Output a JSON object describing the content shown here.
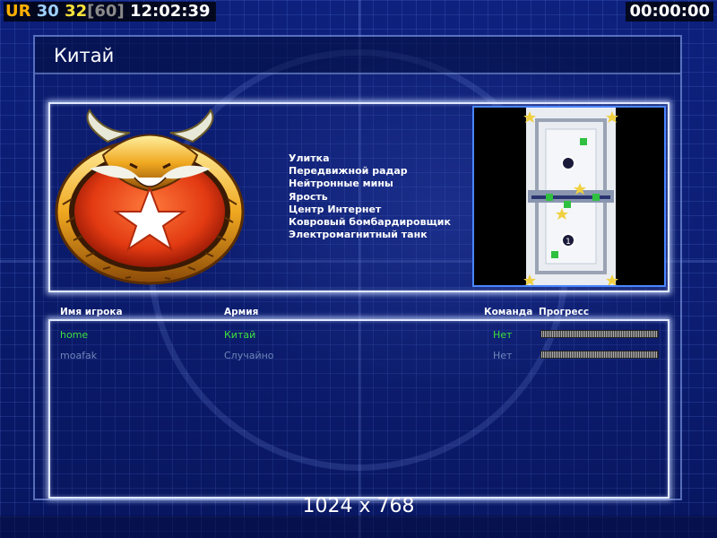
{
  "hud": {
    "tag": "UR",
    "ping": "30",
    "fps": "32",
    "fps_limit": "[60]",
    "clock": "12:02:39",
    "game_timer": "00:00:00"
  },
  "faction": {
    "title": "Китай",
    "emblem_icon": "china-dragon-emblem-icon",
    "units": [
      "Улитка",
      "Передвижной радар",
      "Нейтронные мины",
      "Ярость",
      "Центр Интернет",
      "Ковровый бомбардировщик",
      "Электромагнитный танк"
    ]
  },
  "map_preview": {
    "icon": "minimap-preview",
    "start_positions": [
      "1"
    ]
  },
  "players_table": {
    "headers": {
      "name": "Имя игрока",
      "army": "Армия",
      "team": "Команда",
      "progress": "Прогресс"
    },
    "rows": [
      {
        "name": "home",
        "army": "Китай",
        "team": "Нет",
        "progress": 1.0,
        "color": "#3fe03f"
      },
      {
        "name": "moafak",
        "army": "Случайно",
        "team": "Нет",
        "progress": 1.0,
        "color": "#6f86b8"
      }
    ]
  },
  "footer": {
    "resolution": "1024 x 768"
  },
  "colors": {
    "background": "#0a1a66",
    "accent_border": "#dfe8ff",
    "map_border": "#4a86ff",
    "local_player": "#3fe03f",
    "other_player": "#6f86b8"
  }
}
